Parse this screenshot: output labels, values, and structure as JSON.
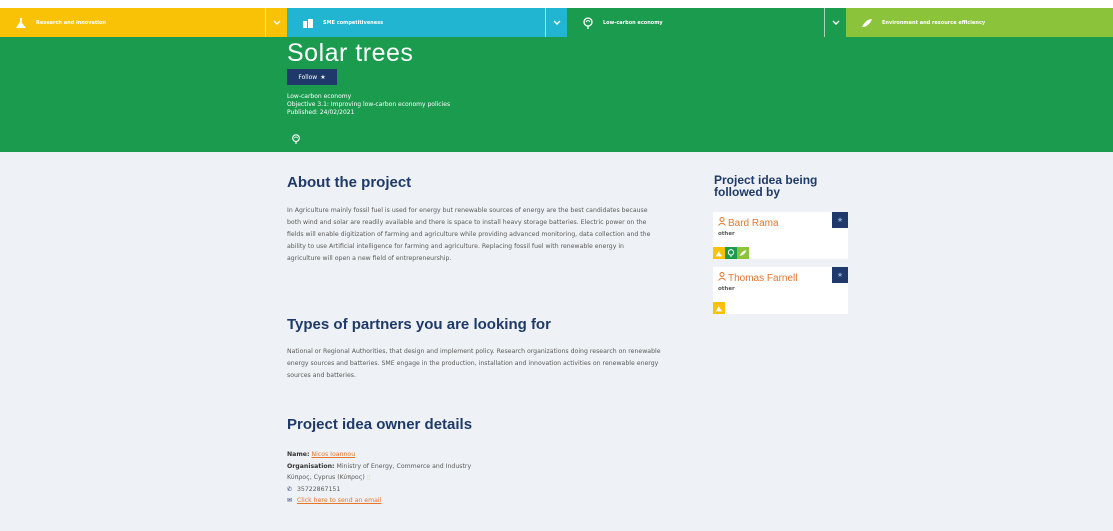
{
  "themes": [
    {
      "label": "Research and innovation",
      "color": "#f9c207",
      "icon": "research-icon"
    },
    {
      "label": "SME competitiveness",
      "color": "#21b5d1",
      "icon": "sme-icon"
    },
    {
      "label": "Low-carbon economy",
      "color": "#1a9b4e",
      "icon": "leaf-globe-icon"
    },
    {
      "label": "Environment and resource efficiency",
      "color": "#8bc43a",
      "icon": "environment-icon"
    }
  ],
  "hero": {
    "title": "Solar trees",
    "follow_label": "Follow",
    "theme": "Low-carbon economy",
    "objective": "Objective 3.1: Improving low-carbon economy policies",
    "published": "Published: 24/02/2021"
  },
  "about": {
    "heading": "About the project",
    "text": "In Agriculture mainly fossil fuel is used for energy but renewable sources of energy are the best candidates because both wind and solar are readily available and there is space to install heavy storage batteries. Electric power on the fields will enable digitization of farming and agriculture while providing advanced monitoring, data collection and the ability to use Artificial intelligence for farming and agriculture. Replacing fossil fuel with renewable energy in agriculture will open a new field of entrepreneurship."
  },
  "partners": {
    "heading": "Types of partners you are looking for",
    "text": "National or Regional Authorities, that design and implement policy. Research organizations doing research on renewable energy sources and batteries. SME engage in the production, installation and innovation activities on renewable energy sources and batteries."
  },
  "owner": {
    "heading": "Project idea owner details",
    "name_label": "Name:",
    "name": "Nicos Ioannou",
    "org_label": "Organisation:",
    "org": "Ministry of Energy, Commerce and Industry",
    "location": "Κύπρος, Cyprus (Κύπρος)",
    "phone": "35722867151",
    "email_link": "Click here to send an email"
  },
  "followers": {
    "heading": "Project idea being followed by",
    "items": [
      {
        "name": "Bard Rama",
        "role": "other",
        "badges": [
          "research-icon",
          "leaf-globe-icon",
          "environment-icon"
        ]
      },
      {
        "name": "Thomas Farnell",
        "role": "other",
        "badges": [
          "research-icon"
        ]
      }
    ]
  },
  "colors": {
    "navy": "#1f3a6a",
    "green": "#1a9b4e",
    "orange_link": "#e5762b",
    "page_bg": "#eef1f5"
  }
}
